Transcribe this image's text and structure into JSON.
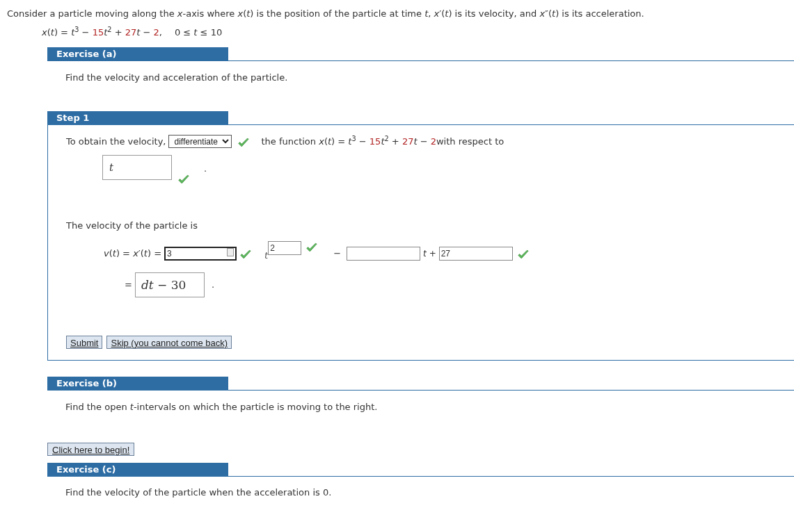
{
  "intro": "Consider a particle moving along the *x*-axis where *x*(*t*) is the position of the particle at time *t*, *x*′(*t*) is its velocity, and *x*″(*t*) is its acceleration.",
  "formula": [
    {
      "text": "*x*(*t*) = *t*$^{3}$ − ",
      "kind": "plain"
    },
    {
      "text": "15",
      "kind": "given"
    },
    {
      "text": "*t*$^{2}$ + ",
      "kind": "plain"
    },
    {
      "text": "27",
      "kind": "given"
    },
    {
      "text": "*t* − ",
      "kind": "plain"
    },
    {
      "text": "2",
      "kind": "given"
    },
    {
      "text": ",",
      "kind": "plain"
    }
  ],
  "domain": "0 ≤ *t* ≤ 10",
  "exercise_a": {
    "title": "Exercise (a)",
    "prompt": "Find the velocity and acceleration of the particle."
  },
  "step": {
    "title": "Step 1",
    "sentence_start": "To obtain the velocity,",
    "dropdown": {
      "value": "differentiate",
      "correct": true
    },
    "sentence_mid": [
      {
        "text": "the function *x*(*t*) = *t*$^{3}$ − ",
        "kind": "plain"
      },
      {
        "text": "15",
        "kind": "given"
      },
      {
        "text": "*t*$^{2}$ + ",
        "kind": "plain"
      },
      {
        "text": "27",
        "kind": "given"
      },
      {
        "text": "*t* − ",
        "kind": "plain"
      },
      {
        "text": "2",
        "kind": "given"
      },
      {
        "text": "with respect to",
        "kind": "plain"
      }
    ],
    "variable_answer": {
      "value": "t",
      "correct": true
    },
    "period": ".",
    "velocity_label": "The velocity of the particle is",
    "velocity_lhs": "*v*(*t*) = *x*′(*t*) =",
    "coef_answer": {
      "value": "3",
      "correct": true,
      "focused": true
    },
    "t_symbol": "t",
    "power_answer": {
      "value": "2",
      "correct": true
    },
    "minus": "−",
    "linear_answer": {
      "correct": false
    },
    "t_plus": "*t* +",
    "const_answer": {
      "value": "27",
      "correct": true
    },
    "equals": "=",
    "result": "*dt* − 30",
    "result_period": ".",
    "buttons": [
      "Submit",
      "Skip (you cannot come back)"
    ]
  },
  "exercise_b": {
    "title": "Exercise (b)",
    "prompt": "Find the open *t*-intervals on which the particle is moving to the right.",
    "button": "Click here to begin!"
  },
  "exercise_c": {
    "title": "Exercise (c)",
    "prompt": "Find the velocity of the particle when the acceleration is 0."
  }
}
